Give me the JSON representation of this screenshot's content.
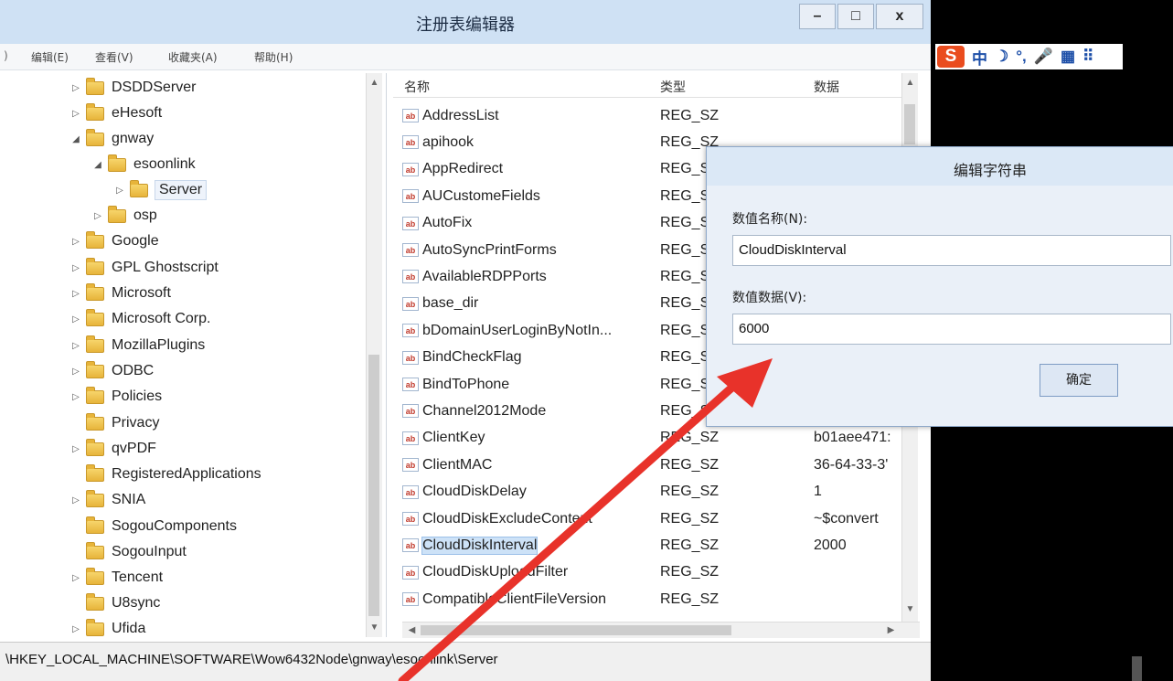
{
  "window": {
    "title": "注册表编辑器",
    "buttons": {
      "minimize": "–",
      "maximize": "□",
      "close": "x"
    }
  },
  "menu": [
    {
      "label": "编辑(E)"
    },
    {
      "label": "查看(V)"
    },
    {
      "label": "收藏夹(A)"
    },
    {
      "label": "帮助(H)"
    }
  ],
  "tree": [
    {
      "label": "DSDDServer",
      "exp": "▷"
    },
    {
      "label": "eHesoft",
      "exp": "▷"
    },
    {
      "label": "gnway",
      "exp": "◢"
    },
    {
      "label": "esoonlink",
      "exp": "◢"
    },
    {
      "label": "Server",
      "exp": "▷"
    },
    {
      "label": "osp",
      "exp": "▷"
    },
    {
      "label": "Google",
      "exp": "▷"
    },
    {
      "label": "GPL Ghostscript",
      "exp": "▷"
    },
    {
      "label": "Microsoft",
      "exp": "▷"
    },
    {
      "label": "Microsoft Corp.",
      "exp": "▷"
    },
    {
      "label": "MozillaPlugins",
      "exp": "▷"
    },
    {
      "label": "ODBC",
      "exp": "▷"
    },
    {
      "label": "Policies",
      "exp": "▷"
    },
    {
      "label": "Privacy",
      "exp": ""
    },
    {
      "label": "qvPDF",
      "exp": "▷"
    },
    {
      "label": "RegisteredApplications",
      "exp": ""
    },
    {
      "label": "SNIA",
      "exp": "▷"
    },
    {
      "label": "SogouComponents",
      "exp": ""
    },
    {
      "label": "SogouInput",
      "exp": ""
    },
    {
      "label": "Tencent",
      "exp": "▷"
    },
    {
      "label": "U8sync",
      "exp": ""
    },
    {
      "label": "Ufida",
      "exp": "▷"
    }
  ],
  "list": {
    "headers": {
      "name": "名称",
      "type": "类型",
      "data": "数据"
    },
    "rows": [
      {
        "name": "AddressList",
        "type": "REG_SZ",
        "data": ""
      },
      {
        "name": "apihook",
        "type": "REG_SZ",
        "data": ""
      },
      {
        "name": "AppRedirect",
        "type": "REG_S",
        "data": ""
      },
      {
        "name": "AUCustomeFields",
        "type": "REG_S",
        "data": ""
      },
      {
        "name": "AutoFix",
        "type": "REG_S",
        "data": ""
      },
      {
        "name": "AutoSyncPrintForms",
        "type": "REG_S",
        "data": ""
      },
      {
        "name": "AvailableRDPPorts",
        "type": "REG_S",
        "data": ""
      },
      {
        "name": "base_dir",
        "type": "REG_S",
        "data": ""
      },
      {
        "name": "bDomainUserLoginByNotIn...",
        "type": "REG_S",
        "data": ""
      },
      {
        "name": "BindCheckFlag",
        "type": "REG_S",
        "data": ""
      },
      {
        "name": "BindToPhone",
        "type": "REG_S",
        "data": ""
      },
      {
        "name": "Channel2012Mode",
        "type": "REG_S",
        "data": ""
      },
      {
        "name": "ClientKey",
        "type": "REG_SZ",
        "data": "b01aee471:"
      },
      {
        "name": "ClientMAC",
        "type": "REG_SZ",
        "data": "36-64-33-3'"
      },
      {
        "name": "CloudDiskDelay",
        "type": "REG_SZ",
        "data": "1"
      },
      {
        "name": "CloudDiskExcludeContent",
        "type": "REG_SZ",
        "data": "~$convert"
      },
      {
        "name": "CloudDiskInterval",
        "type": "REG_SZ",
        "data": "2000"
      },
      {
        "name": "CloudDiskUploadFilter",
        "type": "REG_SZ",
        "data": ""
      },
      {
        "name": "CompatibleClientFileVersion",
        "type": "REG_SZ",
        "data": ""
      }
    ]
  },
  "status": {
    "path": "\\HKEY_LOCAL_MACHINE\\SOFTWARE\\Wow6432Node\\gnway\\esoonlink\\Server"
  },
  "ime": {
    "logo": "S",
    "items": [
      "中",
      "☽",
      "°,",
      "🎤",
      "▦",
      "⠿"
    ]
  },
  "dialog": {
    "title": "编辑字符串",
    "name_label": "数值名称(N):",
    "name_value": "CloudDiskInterval",
    "data_label": "数值数据(V):",
    "data_value": "6000",
    "ok_label": "确定"
  },
  "accent_colors": {
    "arrow": "#e8322a",
    "titlebar": "#cfe1f4",
    "dialog_body": "#eaf0f8"
  }
}
